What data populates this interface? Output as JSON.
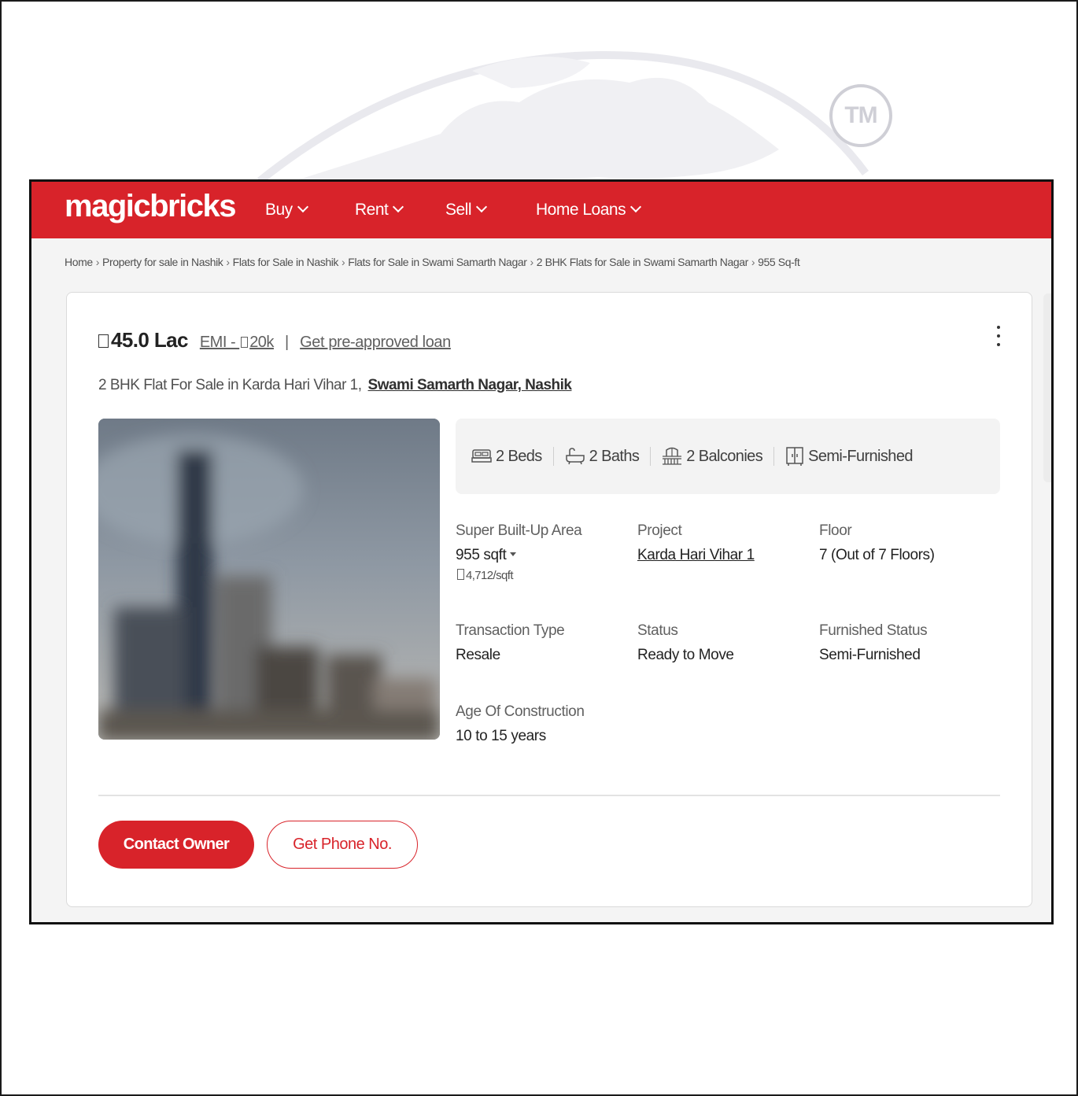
{
  "colors": {
    "brand_red": "#d8232a",
    "text_dark": "#222222",
    "text_muted": "#606060",
    "panel_bg": "#f3f3f3"
  },
  "watermark": {
    "tm": "TM"
  },
  "header": {
    "logo": "magicbricks",
    "nav": [
      {
        "label": "Buy",
        "icon": "chevron-down-icon"
      },
      {
        "label": "Rent",
        "icon": "chevron-down-icon"
      },
      {
        "label": "Sell",
        "icon": "chevron-down-icon"
      },
      {
        "label": "Home Loans",
        "icon": "chevron-down-icon"
      }
    ]
  },
  "breadcrumb": {
    "separator": "›",
    "items": [
      "Home",
      "Property for sale in Nashik",
      "Flats for Sale in Nashik",
      "Flats for Sale in Swami Samarth Nagar",
      "2 BHK Flats for Sale in Swami Samarth Nagar",
      "955 Sq-ft"
    ]
  },
  "listing": {
    "price": "45.0 Lac",
    "emi_prefix": "EMI - ",
    "emi_value": "20k",
    "separator": "|",
    "loan_link": "Get pre-approved loan",
    "title": "2 BHK Flat For Sale in Karda Hari Vihar 1,",
    "location_link": "Swami Samarth Nagar, Nashik",
    "amenities": [
      {
        "icon": "bed-icon",
        "label": "2 Beds"
      },
      {
        "icon": "bathtub-icon",
        "label": "2 Baths"
      },
      {
        "icon": "balcony-icon",
        "label": "2 Balconies"
      },
      {
        "icon": "wardrobe-icon",
        "label": "Semi-Furnished"
      }
    ],
    "specs": {
      "area": {
        "label": "Super Built-Up Area",
        "value": "955 sqft",
        "rate": "4,712/sqft"
      },
      "project": {
        "label": "Project",
        "value": "Karda Hari Vihar 1"
      },
      "floor": {
        "label": "Floor",
        "value": "7 (Out of 7 Floors)"
      },
      "transaction": {
        "label": "Transaction Type",
        "value": "Resale"
      },
      "status": {
        "label": "Status",
        "value": "Ready to Move"
      },
      "furnished": {
        "label": "Furnished Status",
        "value": "Semi-Furnished"
      },
      "age": {
        "label": "Age Of Construction",
        "value": "10 to 15 years"
      }
    },
    "actions": {
      "contact": "Contact Owner",
      "phone": "Get Phone No."
    }
  }
}
